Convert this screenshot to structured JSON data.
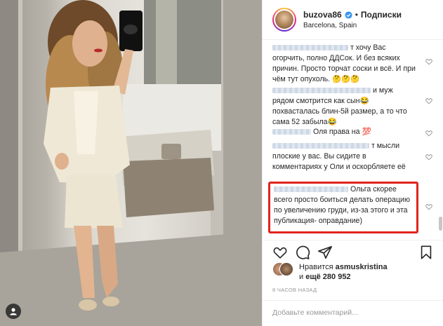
{
  "header": {
    "username": "buzova86",
    "separator": "•",
    "follow_label": "Подписки",
    "location": "Barcelona, Spain"
  },
  "comments": [
    {
      "text": "т хочу Вас огорчить, полно ДДСок. И без всяких причин. Просто торчат соски и всё. И при чём тут опухоль. 🤔🤔🤔"
    },
    {
      "text": "и муж рядом смотрится как сын😂 похвасталась блин-5й размер, а то что сама 52 забыла😂"
    },
    {
      "text": "Оля права на 💯"
    },
    {
      "text": "т мысли плоские у вас. Вы сидите в комментариях у Оли и оскорбляете её"
    },
    {
      "text": "Ольга скорее всего просто боиться делать операцию по увеличению груди, из-за этого и эта публикация- оправдание)"
    }
  ],
  "likes": {
    "prefix": "Нравится",
    "user": "asmuskristina",
    "and_more": "и",
    "count": "ещё 280 952"
  },
  "timestamp": "8 ЧАСОВ НАЗАД",
  "add_comment_placeholder": "Добавьте комментарий...",
  "colors": {
    "highlight": "#e0241d",
    "verified": "#3897f0"
  }
}
